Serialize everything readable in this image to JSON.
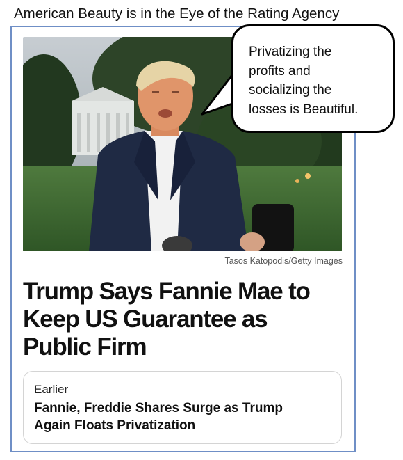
{
  "caption": "American Beauty is in the Eye of the Rating Agency",
  "speech_bubble": {
    "lines": [
      "Privatizing the",
      "profits and",
      "socializing the",
      "losses is Beautiful."
    ]
  },
  "article": {
    "photo_credit": "Tasos Katopodis/Getty Images",
    "headline_lines": [
      "Trump Says Fannie Mae to",
      "Keep US Guarantee as",
      "Public Firm"
    ],
    "related": {
      "label": "Earlier",
      "title_lines": [
        "Fannie, Freddie Shares Surge as Trump",
        "Again Floats Privatization"
      ]
    }
  },
  "colors": {
    "frame_border": "#6f8fc6",
    "card_border": "#d4d4d4"
  }
}
